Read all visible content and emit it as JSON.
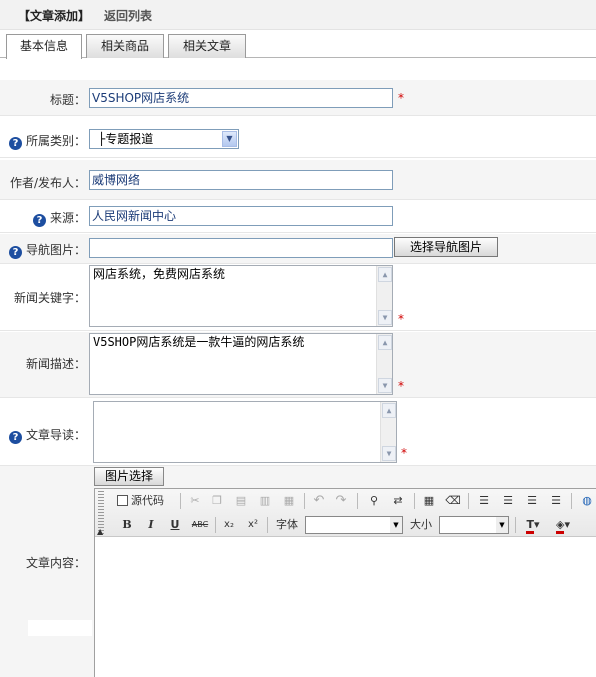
{
  "header": {
    "title": "【文章添加】",
    "back_link": "返回列表"
  },
  "tabs": [
    {
      "label": "基本信息",
      "active": true
    },
    {
      "label": "相关商品",
      "active": false
    },
    {
      "label": "相关文章",
      "active": false
    }
  ],
  "form": {
    "title": {
      "label": "标题：",
      "value": "V5SHOP网店系统",
      "required": "*"
    },
    "category": {
      "label": "所属类别：",
      "value": "├专题报道"
    },
    "author": {
      "label": "作者/发布人：",
      "value": "威博网络"
    },
    "source": {
      "label": "来源：",
      "value": "人民网新闻中心"
    },
    "nav_image": {
      "label": "导航图片：",
      "value": "",
      "button": "选择导航图片"
    },
    "keywords": {
      "label": "新闻关键字：",
      "value": "网店系统，免费网店系统",
      "required": "*"
    },
    "description": {
      "label": "新闻描述：",
      "value": "V5SHOP网店系统是一款牛逼的网店系统",
      "required": "*"
    },
    "intro": {
      "label": "文章导读：",
      "value": "",
      "required": "*"
    },
    "content": {
      "label": "文章内容：",
      "image_button": "图片选择"
    }
  },
  "editor": {
    "source_label": "源代码",
    "font_label": "字体",
    "size_label": "大小",
    "font_value": "",
    "size_value": ""
  },
  "colors": {
    "required": "#d00000",
    "help_icon": "#1d4ea0",
    "input_border": "#7f9db9"
  }
}
